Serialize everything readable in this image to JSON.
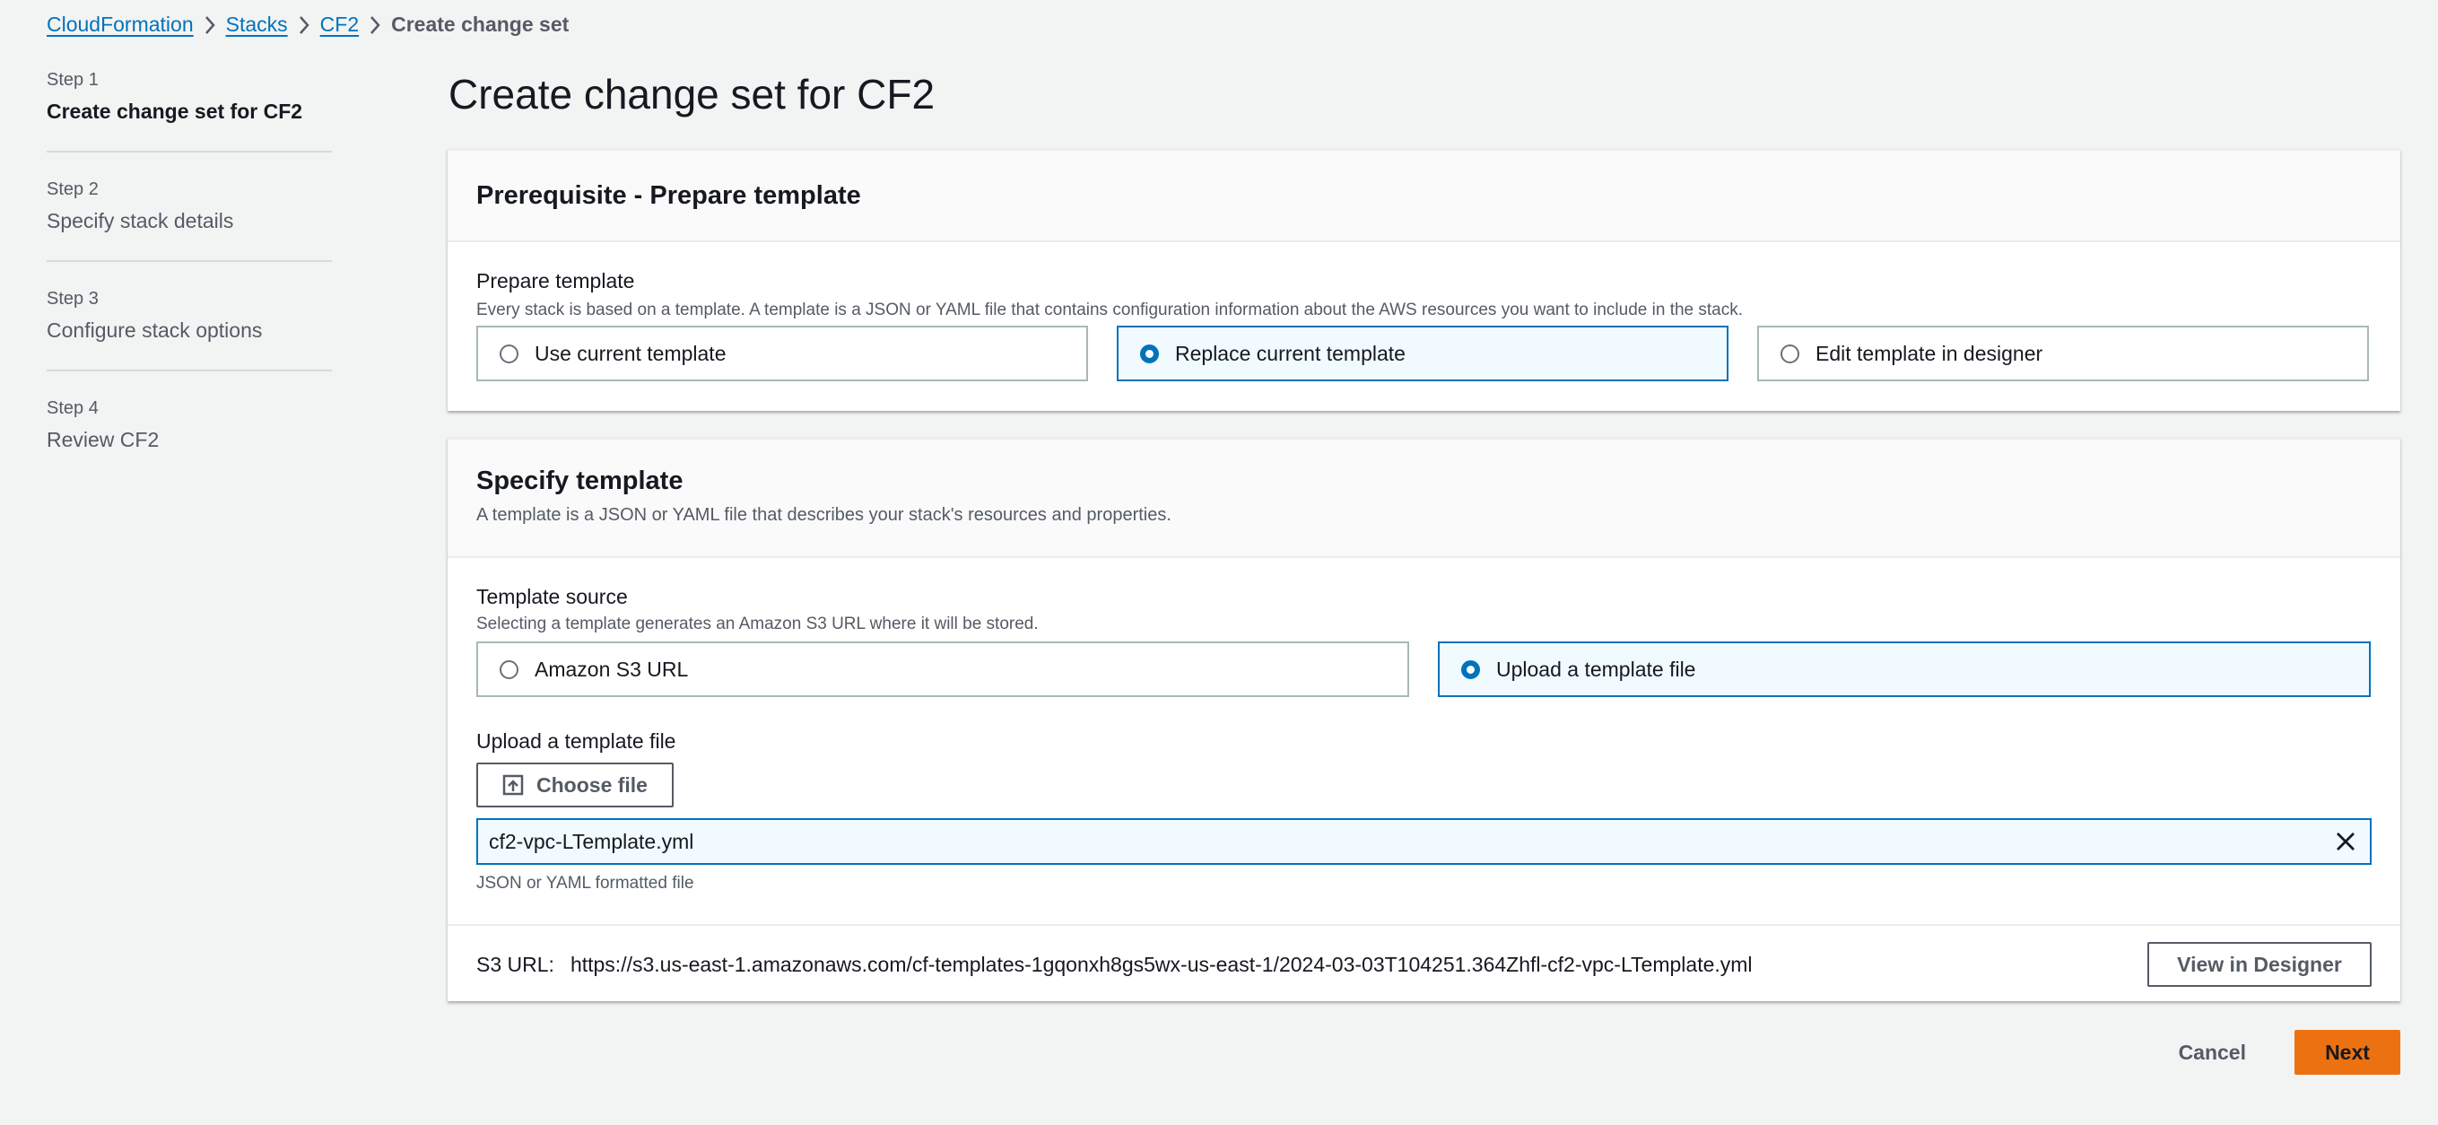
{
  "breadcrumb": {
    "items": [
      "CloudFormation",
      "Stacks",
      "CF2"
    ],
    "current": "Create change set"
  },
  "steps": [
    {
      "num": "Step 1",
      "title": "Create change set for CF2"
    },
    {
      "num": "Step 2",
      "title": "Specify stack details"
    },
    {
      "num": "Step 3",
      "title": "Configure stack options"
    },
    {
      "num": "Step 4",
      "title": "Review CF2"
    }
  ],
  "page_title": "Create change set for CF2",
  "prereq": {
    "heading": "Prerequisite - Prepare template",
    "field_label": "Prepare template",
    "field_desc": "Every stack is based on a template. A template is a JSON or YAML file that contains configuration information about the AWS resources you want to include in the stack.",
    "options": [
      "Use current template",
      "Replace current template",
      "Edit template in designer"
    ],
    "selected": "Replace current template"
  },
  "specify": {
    "heading": "Specify template",
    "desc": "A template is a JSON or YAML file that describes your stack's resources and properties.",
    "source_label": "Template source",
    "source_desc": "Selecting a template generates an Amazon S3 URL where it will be stored.",
    "source_options": [
      "Amazon S3 URL",
      "Upload a template file"
    ],
    "selected": "Upload a template file",
    "upload_label": "Upload a template file",
    "choose_file": "Choose file",
    "file_name": "cf2-vpc-LTemplate.yml",
    "file_hint": "JSON or YAML formatted file",
    "s3_url_label": "S3 URL:",
    "s3_url_value": "https://s3.us-east-1.amazonaws.com/cf-templates-1gqonxh8gs5wx-us-east-1/2024-03-03T104251.364Zhfl-cf2-vpc-LTemplate.yml",
    "view_designer": "View in Designer"
  },
  "actions": {
    "cancel": "Cancel",
    "next": "Next"
  },
  "colors": {
    "link": "#0073bb",
    "selected_border": "#0073bb",
    "selected_bg": "#f1faff",
    "primary": "#ec7211",
    "page_bg": "#f2f3f3"
  }
}
